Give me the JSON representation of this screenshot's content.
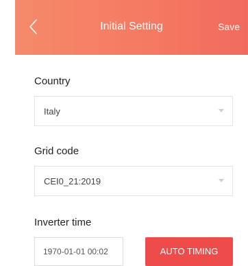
{
  "header": {
    "title": "Initial Setting",
    "save_label": "Save"
  },
  "form": {
    "country": {
      "label": "Country",
      "value": "Italy"
    },
    "grid_code": {
      "label": "Grid code",
      "value": "CEI0_21:2019"
    },
    "inverter_time": {
      "label": "Inverter time",
      "value": "1970-01-01 00:02",
      "button_label": "AUTO TIMING"
    }
  },
  "colors": {
    "header_gradient_start": "#f58a6a",
    "header_gradient_end": "#f26a5f",
    "accent_button": "#ee4b4b"
  },
  "icons": {
    "back": "chevron-left-icon",
    "dropdown": "caret-down-icon"
  }
}
